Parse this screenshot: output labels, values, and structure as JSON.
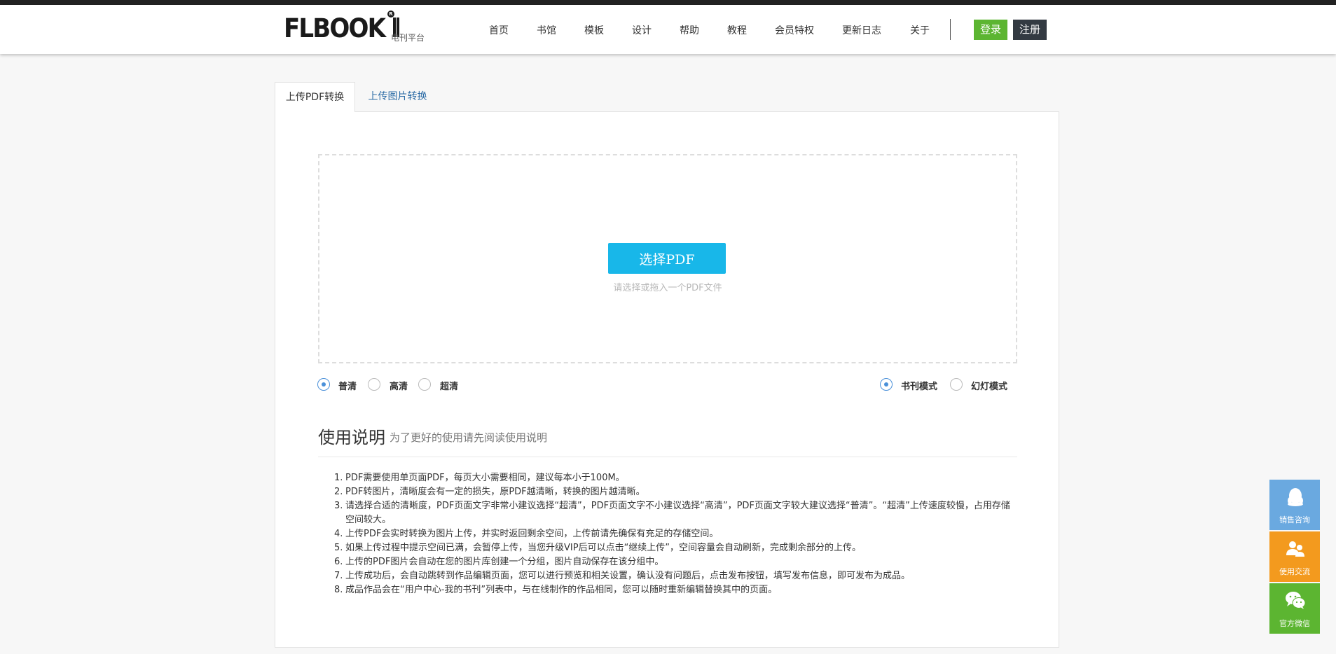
{
  "header": {
    "logo_text": "FLBOOK",
    "logo_reg": "R",
    "logo_sub": "电刊平台",
    "nav": [
      "首页",
      "书馆",
      "模板",
      "设计",
      "帮助",
      "教程",
      "会员特权",
      "更新日志",
      "关于"
    ],
    "login_label": "登录",
    "register_label": "注册"
  },
  "tabs": [
    {
      "label": "上传PDF转换",
      "active": true
    },
    {
      "label": "上传图片转换",
      "active": false
    }
  ],
  "upload": {
    "button_label": "选择PDF",
    "hint": "请选择或拖入一个PDF文件"
  },
  "quality_options": [
    {
      "label": "普清",
      "checked": true
    },
    {
      "label": "高清",
      "checked": false
    },
    {
      "label": "超清",
      "checked": false
    }
  ],
  "mode_options": [
    {
      "label": "书刊模式",
      "checked": true
    },
    {
      "label": "幻灯模式",
      "checked": false
    }
  ],
  "usage": {
    "title": "使用说明",
    "subtitle": "为了更好的使用请先阅读使用说明",
    "items": [
      {
        "num": "1.",
        "text": "PDF需要使用单页面PDF，每页大小需要相同，建议每本小于100M。"
      },
      {
        "num": "2.",
        "text": "PDF转图片，清晰度会有一定的损失，原PDF越清晰，转换的图片越清晰。"
      },
      {
        "num": "3.",
        "text": "请选择合适的清晰度，PDF页面文字非常小建议选择“超清”，PDF页面文字不小建议选择“高清”，PDF页面文字较大建议选择“普清”。“超清”上传速度较慢，占用存储空间较大。"
      },
      {
        "num": "4.",
        "text": "上传PDF会实时转换为图片上传，并实时返回剩余空间，上传前请先确保有充足的存储空间。"
      },
      {
        "num": "5.",
        "text": "如果上传过程中提示空间已满，会暂停上传，当您升级VIP后可以点击“继续上传”，空间容量会自动刷新，完成剩余部分的上传。"
      },
      {
        "num": "6.",
        "text": "上传的PDF图片会自动在您的图片库创建一个分组，图片自动保存在该分组中。"
      },
      {
        "num": "7.",
        "text": "上传成功后，会自动跳转到作品编辑页面，您可以进行预览和相关设置，确认没有问题后，点击发布按钮，填写发布信息，即可发布为成品。"
      },
      {
        "num": "8.",
        "text": "成品作品会在“用户中心-我的书刊”列表中，与在线制作的作品相同，您可以随时重新编辑替换其中的页面。"
      }
    ]
  },
  "side_buttons": [
    {
      "label": "销售咨询",
      "icon": "qq-icon",
      "color": "#6aa9e0"
    },
    {
      "label": "使用交流",
      "icon": "group-icon",
      "color": "#f39a1e"
    },
    {
      "label": "官方微信",
      "icon": "wechat-icon",
      "color": "#5cb531"
    }
  ]
}
